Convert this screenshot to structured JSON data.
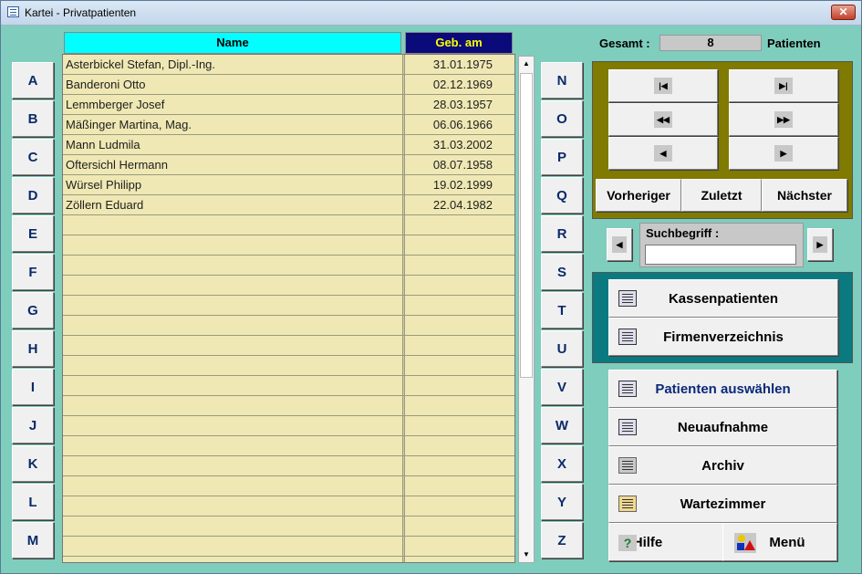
{
  "window": {
    "title": "Kartei - Privatpatienten",
    "close_symbol": "✕"
  },
  "letters_left": [
    "A",
    "B",
    "C",
    "D",
    "E",
    "F",
    "G",
    "H",
    "I",
    "J",
    "K",
    "L",
    "M"
  ],
  "letters_right": [
    "N",
    "O",
    "P",
    "Q",
    "R",
    "S",
    "T",
    "U",
    "V",
    "W",
    "X",
    "Y",
    "Z"
  ],
  "table": {
    "headers": {
      "name": "Name",
      "date": "Geb. am"
    },
    "header_colors": {
      "name_bg": "#00ffff",
      "date_bg": "#0a0a7a",
      "date_fg": "#ffff00"
    },
    "rows": [
      {
        "name": "Asterbickel Stefan, Dipl.-Ing.",
        "date": "31.01.1975"
      },
      {
        "name": "Banderoni Otto",
        "date": "02.12.1969"
      },
      {
        "name": "Lemmberger Josef",
        "date": "28.03.1957"
      },
      {
        "name": "Mäßinger Martina, Mag.",
        "date": "06.06.1966"
      },
      {
        "name": "Mann Ludmila",
        "date": "31.03.2002"
      },
      {
        "name": "Oftersichl Hermann",
        "date": "08.07.1958"
      },
      {
        "name": "Würsel Philipp",
        "date": "19.02.1999"
      },
      {
        "name": "Zöllern Eduard",
        "date": "22.04.1982"
      }
    ]
  },
  "summary": {
    "gesamt_label": "Gesamt :",
    "count": "8",
    "unit_label": "Patienten"
  },
  "navigation": {
    "icons": [
      "first-record-icon",
      "last-record-icon",
      "page-back-icon",
      "page-forward-icon",
      "previous-icon",
      "next-icon"
    ],
    "glyphs": {
      "first": "|◀",
      "last": "▶|",
      "rew": "◀◀",
      "ff": "▶▶",
      "prev": "◀",
      "next": "▶"
    },
    "previous_label": "Vorheriger",
    "last_label": "Zuletzt",
    "next_label": "Nächster"
  },
  "search": {
    "label": "Suchbegriff :",
    "value": "",
    "left_glyph": "◀",
    "right_glyph": "▶"
  },
  "actions": {
    "kassen": "Kassenpatienten",
    "firmen": "Firmenverzeichnis",
    "auswaehlen": "Patienten auswählen",
    "neuaufnahme": "Neuaufnahme",
    "archiv": "Archiv",
    "wartezimmer": "Wartezimmer",
    "hilfe": "Hilfe",
    "hilfe_icon": "?",
    "menue": "Menü"
  },
  "scrollbar": {
    "up": "▲",
    "down": "▼"
  }
}
